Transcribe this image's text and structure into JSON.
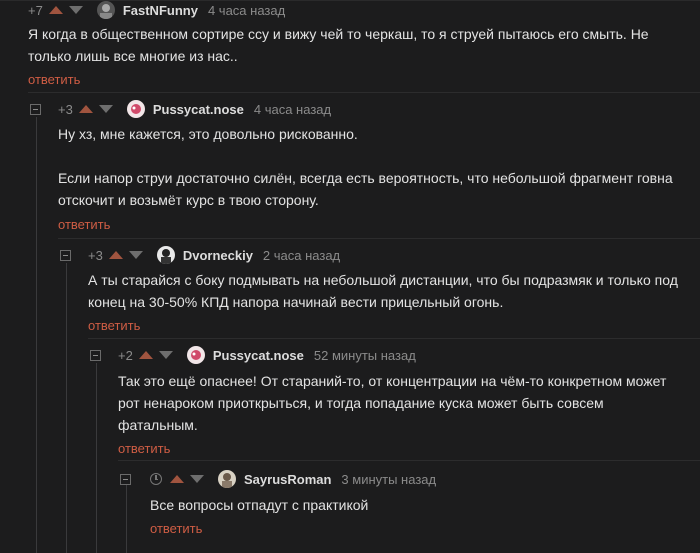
{
  "reply_label": "ответить",
  "comments": [
    {
      "rating": "+7",
      "author": "FastNFunny",
      "time": "4 часа назад",
      "text": "Я когда в общественном сортире ссу и вижу чей то черкаш, то я струей пытаюсь его смыть. Не только лишь все многие из нас.."
    },
    {
      "rating": "+3",
      "author": "Pussycat.nose",
      "time": "4 часа назад",
      "text": "Ну хз, мне кажется, это довольно рискованно.\n\nЕсли напор струи достаточно силён, всегда есть вероятность, что небольшой фрагмент говна отскочит и возьмёт курс в твою сторону."
    },
    {
      "rating": "+3",
      "author": "Dvorneckiy",
      "time": "2 часа назад",
      "text": "А ты старайся с боку подмывать на небольшой дистанции, что бы подразмяк и только под конец на 30-50% КПД напора начинай вести прицельный огонь."
    },
    {
      "rating": "+2",
      "author": "Pussycat.nose",
      "time": "52 минуты назад",
      "text": "Так это ещё опаснее! От стараний-то, от концентрации на чём-то конкретном может рот ненароком приоткрыться, и тогда попадание куска может быть совсем фатальным."
    },
    {
      "rating": "",
      "author": "SayrusRoman",
      "time": "3 минуты назад",
      "text": "Все вопросы отпадут с практикой"
    }
  ],
  "colors": {
    "background": "#1c1c1d",
    "text": "#e3e3e3",
    "meta": "#8b8b8b",
    "reply_link": "#cf5d44",
    "upvote": "#a0543f"
  }
}
